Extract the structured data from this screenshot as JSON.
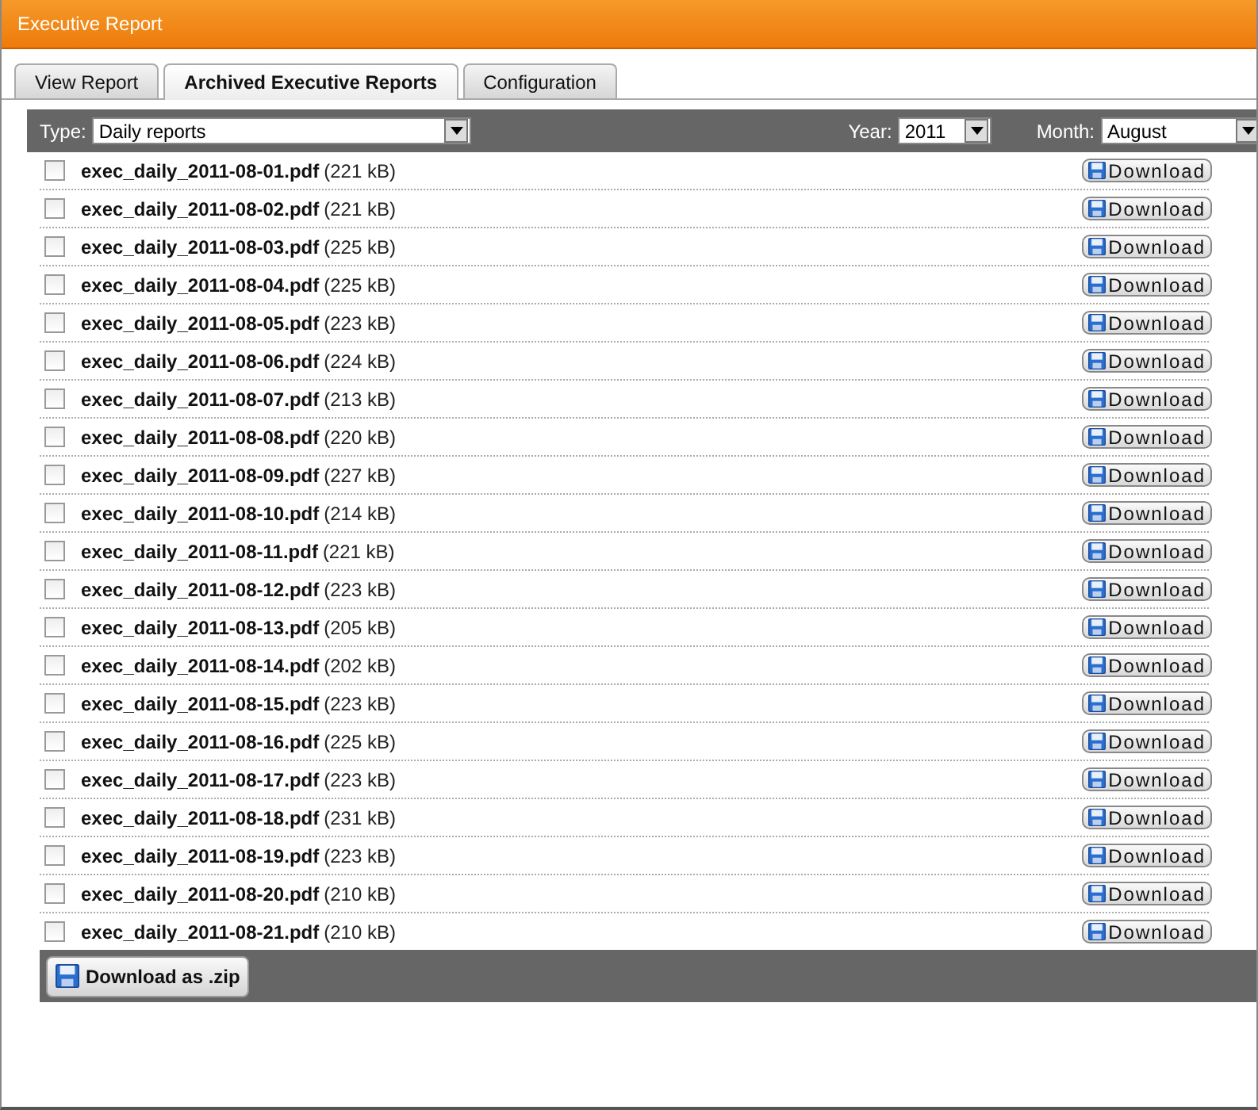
{
  "window": {
    "title": "Executive Report"
  },
  "tabs": [
    {
      "label": "View Report",
      "selected": false
    },
    {
      "label": "Archived Executive Reports",
      "selected": true
    },
    {
      "label": "Configuration",
      "selected": false
    }
  ],
  "filters": {
    "type_label": "Type:",
    "type_value": "Daily reports",
    "year_label": "Year:",
    "year_value": "2011",
    "month_label": "Month:",
    "month_value": "August"
  },
  "files": [
    {
      "name": "exec_daily_2011-08-01.pdf",
      "size": "(221 kB)",
      "checked": false,
      "action": "Download"
    },
    {
      "name": "exec_daily_2011-08-02.pdf",
      "size": "(221 kB)",
      "checked": false,
      "action": "Download"
    },
    {
      "name": "exec_daily_2011-08-03.pdf",
      "size": "(225 kB)",
      "checked": false,
      "action": "Download"
    },
    {
      "name": "exec_daily_2011-08-04.pdf",
      "size": "(225 kB)",
      "checked": false,
      "action": "Download"
    },
    {
      "name": "exec_daily_2011-08-05.pdf",
      "size": "(223 kB)",
      "checked": false,
      "action": "Download"
    },
    {
      "name": "exec_daily_2011-08-06.pdf",
      "size": "(224 kB)",
      "checked": false,
      "action": "Download"
    },
    {
      "name": "exec_daily_2011-08-07.pdf",
      "size": "(213 kB)",
      "checked": false,
      "action": "Download"
    },
    {
      "name": "exec_daily_2011-08-08.pdf",
      "size": "(220 kB)",
      "checked": false,
      "action": "Download"
    },
    {
      "name": "exec_daily_2011-08-09.pdf",
      "size": "(227 kB)",
      "checked": false,
      "action": "Download"
    },
    {
      "name": "exec_daily_2011-08-10.pdf",
      "size": "(214 kB)",
      "checked": false,
      "action": "Download"
    },
    {
      "name": "exec_daily_2011-08-11.pdf",
      "size": "(221 kB)",
      "checked": false,
      "action": "Download"
    },
    {
      "name": "exec_daily_2011-08-12.pdf",
      "size": "(223 kB)",
      "checked": false,
      "action": "Download"
    },
    {
      "name": "exec_daily_2011-08-13.pdf",
      "size": "(205 kB)",
      "checked": false,
      "action": "Download"
    },
    {
      "name": "exec_daily_2011-08-14.pdf",
      "size": "(202 kB)",
      "checked": false,
      "action": "Download"
    },
    {
      "name": "exec_daily_2011-08-15.pdf",
      "size": "(223 kB)",
      "checked": false,
      "action": "Download"
    },
    {
      "name": "exec_daily_2011-08-16.pdf",
      "size": "(225 kB)",
      "checked": false,
      "action": "Download"
    },
    {
      "name": "exec_daily_2011-08-17.pdf",
      "size": "(223 kB)",
      "checked": false,
      "action": "Download"
    },
    {
      "name": "exec_daily_2011-08-18.pdf",
      "size": "(231 kB)",
      "checked": false,
      "action": "Download"
    },
    {
      "name": "exec_daily_2011-08-19.pdf",
      "size": "(223 kB)",
      "checked": false,
      "action": "Download"
    },
    {
      "name": "exec_daily_2011-08-20.pdf",
      "size": "(210 kB)",
      "checked": false,
      "action": "Download"
    },
    {
      "name": "exec_daily_2011-08-21.pdf",
      "size": "(210 kB)",
      "checked": false,
      "action": "Download"
    }
  ],
  "zip_button": "Download as .zip"
}
